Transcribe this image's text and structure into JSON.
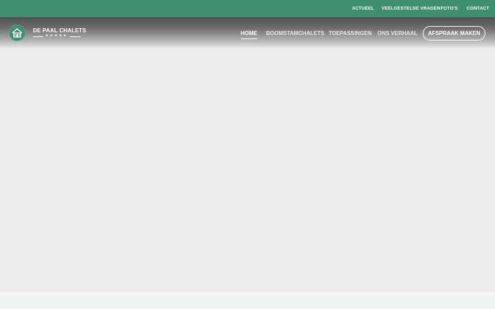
{
  "utility_nav": {
    "items": [
      {
        "label": "ACTUEEL"
      },
      {
        "label": "VEELGESTELDE VRAGEN"
      },
      {
        "label": "FOTO'S"
      },
      {
        "label": "CONTACT"
      }
    ]
  },
  "logo": {
    "name": "DE PAAL CHALETS",
    "stars": "★★★★★"
  },
  "main_nav": {
    "items": [
      {
        "label": "HOME",
        "active": true
      },
      {
        "label": "BOOMSTAMCHALETS"
      },
      {
        "label": "TOEPASSINGEN"
      },
      {
        "label": "ONS VERHAAL"
      }
    ],
    "cta_label": "AFSPRAAK MAKEN"
  },
  "colors": {
    "brand_green": "#3f8e70",
    "hero_background": "#ebeceb",
    "page_background": "#f2f4f3"
  }
}
